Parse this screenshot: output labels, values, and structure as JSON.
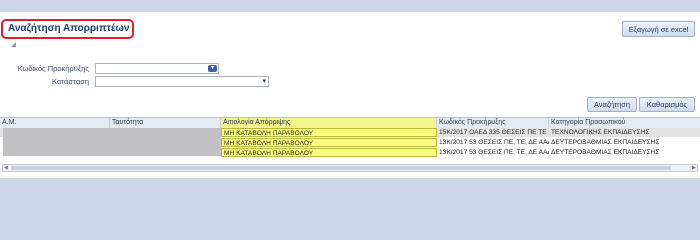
{
  "page": {
    "title": "Αναζήτηση Απορριπτέων",
    "export_label": "Εξαγωγή σε excel"
  },
  "form": {
    "notice_code_label": "Κωδικός Προκήρυξης",
    "status_label": "Κατάσταση",
    "notice_code_value": "",
    "status_value": ""
  },
  "actions": {
    "search_label": "Αναζήτηση",
    "clear_label": "Καθαρισμός"
  },
  "grid": {
    "columns": [
      "Α.Μ.",
      "Ταυτότητα",
      "Αιτιολογία Απόρριψης",
      "Κωδικός Προκήρυξης",
      "Κατηγορία Προσωπικού"
    ],
    "rows": [
      [
        "",
        "",
        "ΜΗ ΚΑΤΑΒΟΛΗ ΠΑΡΑΒΟΛΟΥ",
        "15Κ/2017 ΟΑΕΔ 335 ΘΕΣΕΙΣ ΠΕ ΤΕ",
        "ΤΕΧΝΟΛΟΓΙΚΗΣ ΕΚΠΑΙΔΕΥΣΗΣ"
      ],
      [
        "",
        "",
        "ΜΗ ΚΑΤΑΒΟΛΗ ΠΑΡΑΒΟΛΟΥ",
        "13Κ/2017 53 ΘΕΣΕΙΣ ΠΕ, ΤΕ, ΔΕ ΑΑΔΕ...",
        "ΔΕΥΤΕΡΟΒΑΘΜΙΑΣ ΕΚΠΑΙΔΕΥΣΗΣ"
      ],
      [
        "",
        "",
        "ΜΗ ΚΑΤΑΒΟΛΗ ΠΑΡΑΒΟΛΟΥ",
        "13Κ/2017 53 ΘΕΣΕΙΣ ΠΕ, ΤΕ, ΔΕ ΑΑΔΕ...",
        "ΔΕΥΤΕΡΟΒΑΘΜΙΑΣ ΕΚΠΑΙΔΕΥΣΗΣ"
      ]
    ]
  },
  "colors": {
    "highlight": "#fdfd7c",
    "title_border": "#e0202f",
    "title_text": "#153c7a"
  }
}
